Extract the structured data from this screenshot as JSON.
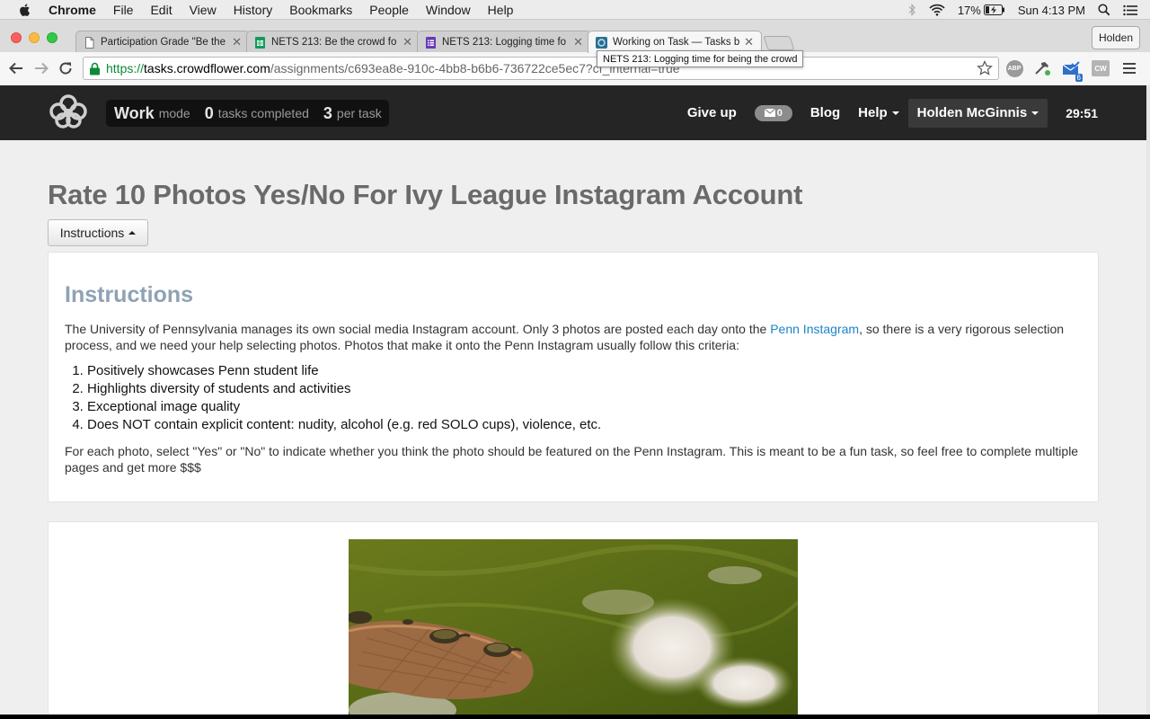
{
  "menubar": {
    "items": [
      "Chrome",
      "File",
      "Edit",
      "View",
      "History",
      "Bookmarks",
      "People",
      "Window",
      "Help"
    ],
    "battery": "17%",
    "clock": "Sun 4:13 PM"
  },
  "browser": {
    "tabs": [
      {
        "title": "Participation Grade \"Be the",
        "icon": "document-icon"
      },
      {
        "title": "NETS 213: Be the crowd fo",
        "icon": "sheets-icon"
      },
      {
        "title": "NETS 213: Logging time fo",
        "icon": "forms-icon"
      },
      {
        "title": "Working on Task — Tasks b",
        "icon": "crowdflower-icon"
      }
    ],
    "profile_name": "Holden",
    "url": {
      "scheme": "https://",
      "host": "tasks.crowdflower.com",
      "path": "/assignments/c693ea8e-910c-4bb8-b6b6-736722ce5ec7?cf_internal=true"
    },
    "tooltip": "NETS 213: Logging time for being the crowd",
    "extensions": {
      "abp": "ABP",
      "mail_badge": "6",
      "cw": "CW"
    }
  },
  "cf_nav": {
    "work_label": "Work",
    "mode_label": "mode",
    "tasks_completed": "0",
    "tasks_completed_label": "tasks completed",
    "per_task": "3",
    "per_task_label": "per task",
    "give_up": "Give up",
    "messages_count": "0",
    "blog": "Blog",
    "help": "Help",
    "user": "Holden McGinnis",
    "timer": "29:51"
  },
  "job": {
    "title": "Rate 10 Photos Yes/No For Ivy League Instagram Account",
    "instructions_button": "Instructions"
  },
  "instructions": {
    "heading": "Instructions",
    "intro_before_link": "The University of Pennsylvania manages its own social media Instagram account. Only 3 photos are posted each day onto the ",
    "link_text": "Penn Instagram",
    "intro_after_link": ", so there is a very rigorous selection process, and we need your help selecting photos. Photos that make it onto the Penn Instagram usually follow this criteria:",
    "criteria": [
      "Positively showcases Penn student life",
      "Highlights diversity of students and activities",
      "Exceptional image quality",
      "Does NOT contain explicit content: nudity, alcohol (e.g. red SOLO cups), violence, etc."
    ],
    "outro": "For each photo, select \"Yes\" or \"No\" to indicate whether you think the photo should be featured on the Penn Instagram. This is meant to be a fun task, so feel free to complete multiple pages and get more $$$"
  },
  "colors": {
    "nav_bg": "#252525",
    "title_gray": "#6a6a6a",
    "heading_blue": "#8ea2b4",
    "link_blue": "#1a85c8",
    "url_green": "#0b8a38"
  }
}
